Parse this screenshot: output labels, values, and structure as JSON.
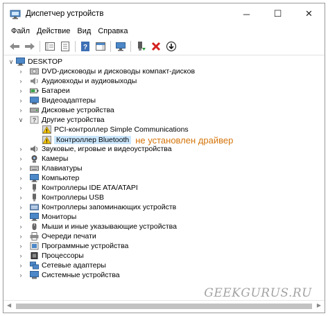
{
  "window": {
    "title": "Диспетчер устройств",
    "controls": {
      "minimize": "─",
      "maximize": "☐",
      "close": "✕"
    }
  },
  "menu": [
    "Файл",
    "Действие",
    "Вид",
    "Справка"
  ],
  "tree": {
    "root": "DESKTOP",
    "categories": [
      {
        "label": "DVD-дисководы и дисководы компакт-дисков",
        "icon": "dvd-drive-icon"
      },
      {
        "label": "Аудиовходы и аудиовыходы",
        "icon": "speaker-icon"
      },
      {
        "label": "Батареи",
        "icon": "battery-icon"
      },
      {
        "label": "Видеоадаптеры",
        "icon": "display-adapter-icon"
      },
      {
        "label": "Дисковые устройства",
        "icon": "disk-drive-icon"
      },
      {
        "label": "Другие устройства",
        "icon": "unknown-device-icon",
        "expanded": true,
        "children": [
          {
            "label": "PCI-контроллер Simple Communications",
            "icon": "warning-device-icon"
          },
          {
            "label": "Контроллер Bluetooth",
            "icon": "warning-device-icon",
            "selected": true
          }
        ]
      },
      {
        "label": "Звуковые, игровые и видеоустройства",
        "icon": "sound-device-icon"
      },
      {
        "label": "Камеры",
        "icon": "camera-icon"
      },
      {
        "label": "Клавиатуры",
        "icon": "keyboard-icon"
      },
      {
        "label": "Компьютер",
        "icon": "computer-icon"
      },
      {
        "label": "Контроллеры IDE ATA/ATAPI",
        "icon": "ide-controller-icon"
      },
      {
        "label": "Контроллеры USB",
        "icon": "usb-icon"
      },
      {
        "label": "Контроллеры запоминающих устройств",
        "icon": "storage-controller-icon"
      },
      {
        "label": "Мониторы",
        "icon": "monitor-icon"
      },
      {
        "label": "Мыши и иные указывающие устройства",
        "icon": "mouse-icon"
      },
      {
        "label": "Очереди печати",
        "icon": "printer-icon"
      },
      {
        "label": "Программные устройства",
        "icon": "software-device-icon"
      },
      {
        "label": "Процессоры",
        "icon": "processor-icon"
      },
      {
        "label": "Сетевые адаптеры",
        "icon": "network-adapter-icon"
      },
      {
        "label": "Системные устройства",
        "icon": "system-device-icon"
      }
    ]
  },
  "annotation": "не установлен драйвер",
  "watermark": "GEEKGURUS.RU",
  "colors": {
    "selection": "#cce8ff",
    "annotation": "#d4740a",
    "watermark": "#a3a3a3"
  }
}
